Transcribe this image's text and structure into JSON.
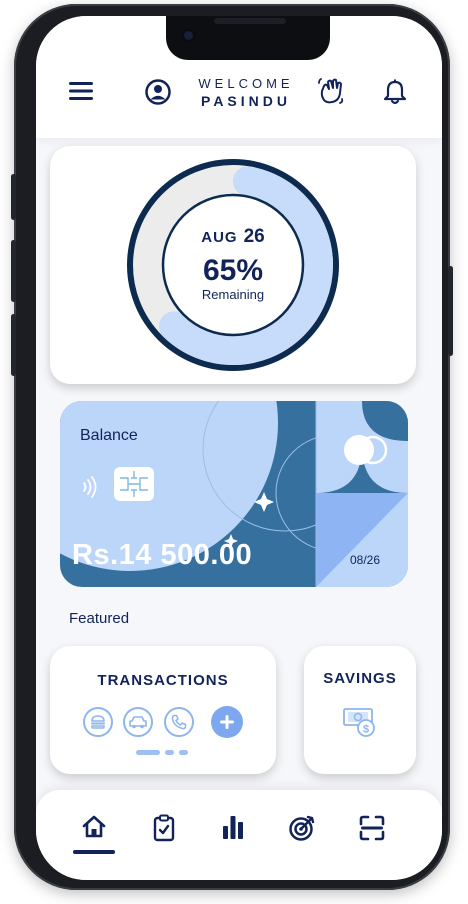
{
  "header": {
    "welcome": "WELCOME",
    "username": "PASINDU",
    "icons": [
      "menu-icon",
      "profile-icon",
      "waving-hand-icon",
      "bell-icon"
    ]
  },
  "progress": {
    "month": "AUG",
    "day": "26",
    "percent_text": "65%",
    "remaining_label": "Remaining",
    "remaining_fraction": 0.65,
    "colors": {
      "remaining": "#c7dcfb",
      "used": "#ececec",
      "ring_border": "#0d2b4e"
    }
  },
  "balance": {
    "label": "Balance",
    "amount": "Rs.14 500.00",
    "expiry": "08/26",
    "icons": [
      "contactless-icon",
      "card-chip-icon",
      "card-brand-icon"
    ],
    "colors": {
      "card": "#35709f",
      "accent": "#bcd6fa"
    }
  },
  "featured": {
    "label": "Featured"
  },
  "transactions": {
    "title": "TRANSACTIONS",
    "icons": [
      "food-icon",
      "car-icon",
      "phone-icon",
      "add-icon"
    ]
  },
  "savings": {
    "title": "SAVINGS",
    "icon": "money-icon"
  },
  "nav": {
    "items": [
      "home-icon",
      "tasks-icon",
      "stats-icon",
      "goals-icon",
      "scan-icon"
    ],
    "active": "home-icon"
  }
}
